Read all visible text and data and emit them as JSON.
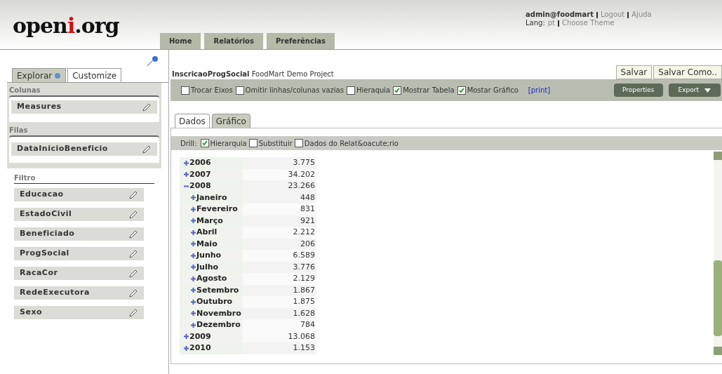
{
  "logo": {
    "parts": [
      {
        "text": "open",
        "accent": false
      },
      {
        "text": "i",
        "accent": true
      },
      {
        "text": ".org",
        "accent": false
      }
    ]
  },
  "user": {
    "name": "admin@foodmart",
    "links": [
      "Logout",
      "Ajuda"
    ],
    "lang_label": "Lang:",
    "lang": "pt",
    "theme_link": "Choose Theme"
  },
  "nav_tabs": [
    {
      "label": "Home",
      "selected": false
    },
    {
      "label": "Relatórios",
      "selected": false
    },
    {
      "label": "Preferências",
      "selected": false
    }
  ],
  "side_tabs": [
    {
      "label": "Explorar",
      "selected": false
    },
    {
      "label": "Customize",
      "selected": true
    }
  ],
  "columns": {
    "title": "Colunas",
    "items": [
      "Measures"
    ]
  },
  "rows": {
    "title": "Filas",
    "items": [
      "DataInicioBeneficio"
    ]
  },
  "filter": {
    "title": "Filtro",
    "items": [
      "Educacao",
      "EstadoCivil",
      "Beneficiado",
      "ProgSocial",
      "RacaCor",
      "RedeExecutora",
      "Sexo"
    ]
  },
  "report": {
    "name": "InscricaoProgSocial",
    "project": "FoodMart Demo Project",
    "buttons": [
      "Salvar",
      "Salvar Como.."
    ]
  },
  "options": [
    {
      "label": "Trocar Eixos",
      "checked": false
    },
    {
      "label": "Omitir linhas/colunas vazias",
      "checked": false
    },
    {
      "label": "Hieraquia",
      "checked": false
    },
    {
      "label": "Mostrar Tabela",
      "checked": true
    },
    {
      "label": "Mostar Gráfico",
      "checked": true
    }
  ],
  "print_link": "[print]",
  "toolbar_buttons": [
    "Properties",
    "Export"
  ],
  "view_tabs": [
    {
      "label": "Dados",
      "selected": true
    },
    {
      "label": "Gráfico",
      "selected": false
    }
  ],
  "drill": {
    "label": "Drill:",
    "options": [
      {
        "label": "Hierarquia",
        "checked": true
      },
      {
        "label": "Substituir",
        "checked": false
      },
      {
        "label": "Dados do Relat&oacute;rio",
        "checked": false
      }
    ]
  },
  "tree": [
    {
      "label": "2006",
      "value": "3.775",
      "expanded": false
    },
    {
      "label": "2007",
      "value": "34.202",
      "expanded": false
    },
    {
      "label": "2008",
      "value": "23.266",
      "expanded": true,
      "children": [
        {
          "label": "Janeiro",
          "value": "448",
          "expanded": false
        },
        {
          "label": "Fevereiro",
          "value": "831",
          "expanded": false
        },
        {
          "label": "Março",
          "value": "921",
          "expanded": false
        },
        {
          "label": "Abril",
          "value": "2.212",
          "expanded": false
        },
        {
          "label": "Maio",
          "value": "206",
          "expanded": false
        },
        {
          "label": "Junho",
          "value": "6.589",
          "expanded": false
        },
        {
          "label": "Julho",
          "value": "3.776",
          "expanded": false
        },
        {
          "label": "Agosto",
          "value": "2.129",
          "expanded": false
        },
        {
          "label": "Setembro",
          "value": "1.867",
          "expanded": false
        },
        {
          "label": "Outubro",
          "value": "1.875",
          "expanded": false
        },
        {
          "label": "Novembro",
          "value": "1.628",
          "expanded": false
        },
        {
          "label": "Dezembro",
          "value": "784",
          "expanded": false
        }
      ]
    },
    {
      "label": "2009",
      "value": "13.068",
      "expanded": false
    },
    {
      "label": "2010",
      "value": "1.153",
      "expanded": false
    }
  ]
}
